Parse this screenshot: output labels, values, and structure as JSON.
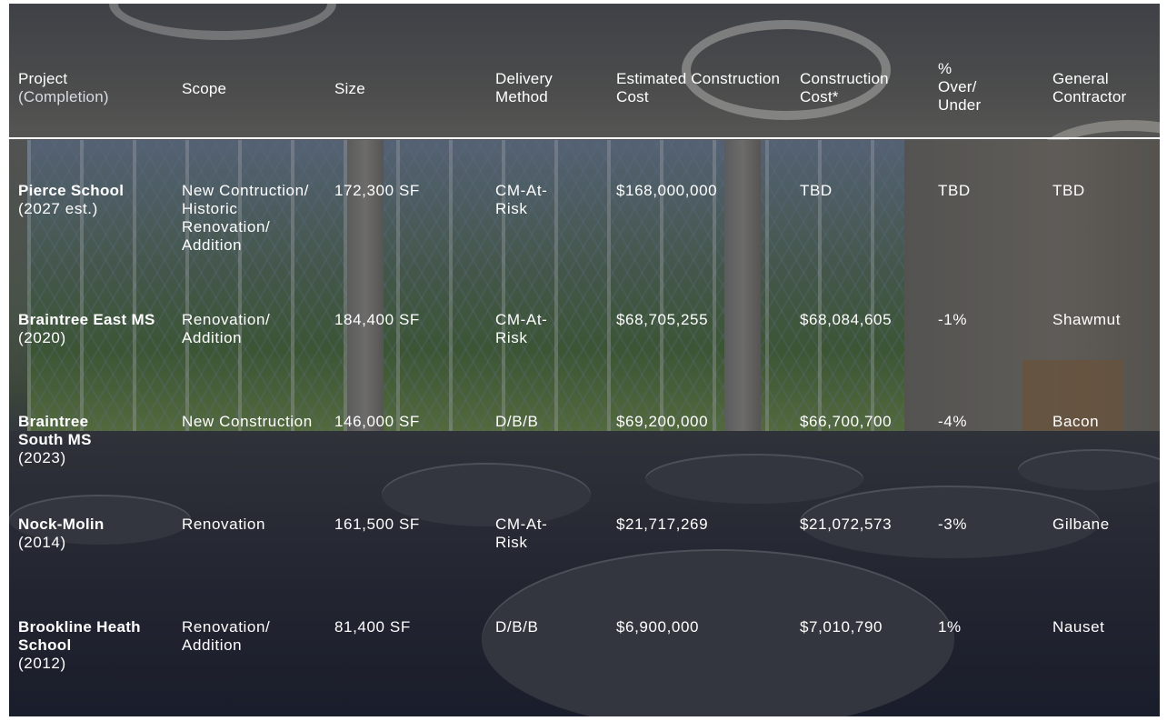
{
  "headers": [
    {
      "label": "Project",
      "sub": "(Completion)"
    },
    {
      "label": "Scope"
    },
    {
      "label": "Size"
    },
    {
      "label": "Delivery Method"
    },
    {
      "label": "Estimated Construction Cost"
    },
    {
      "label": "Construction Cost*"
    },
    {
      "label": "% Over/ Under"
    },
    {
      "label": "General Contractor"
    }
  ],
  "rows": [
    {
      "project": "Pierce School",
      "completion": "(2027 est.)",
      "scope": "New Contruction/ Historic Renovation/ Addition",
      "size": "172,300 SF",
      "delivery": "CM-At-Risk",
      "estimated_cost": "$168,000,000",
      "construction_cost": "TBD",
      "over_under": "TBD",
      "contractor": "TBD"
    },
    {
      "project": "Braintree East MS",
      "completion": "(2020)",
      "scope": "Renovation/ Addition",
      "size": "184,400 SF",
      "delivery": "CM-At-Risk",
      "estimated_cost": "$68,705,255",
      "construction_cost": "$68,084,605",
      "over_under": "-1%",
      "contractor": "Shawmut"
    },
    {
      "project": "Braintree South MS",
      "completion": "(2023)",
      "scope": "New Construction",
      "size": "146,000 SF",
      "delivery": "D/B/B",
      "estimated_cost": "$69,200,000",
      "construction_cost": "$66,700,700",
      "over_under": "-4%",
      "contractor": "Bacon"
    },
    {
      "project": "Nock-Molin",
      "completion": "(2014)",
      "scope": "Renovation",
      "size": "161,500 SF",
      "delivery": "CM-At-Risk",
      "estimated_cost": "$21,717,269",
      "construction_cost": "$21,072,573",
      "over_under": "-3%",
      "contractor": "Gilbane"
    },
    {
      "project": "Brookline Heath School",
      "completion": "(2012)",
      "scope": "Renovation/ Addition",
      "size": "81,400 SF",
      "delivery": "D/B/B",
      "estimated_cost": "$6,900,000",
      "construction_cost": "$7,010,790",
      "over_under": "1%",
      "contractor": "Nauset"
    }
  ]
}
